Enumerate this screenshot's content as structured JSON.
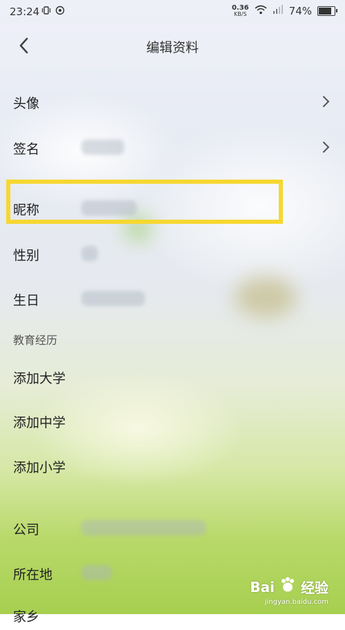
{
  "status_bar": {
    "time": "23:24",
    "speed_value": "0.36",
    "speed_unit": "KB/S",
    "battery_percent": "74%",
    "battery_level": 0.74
  },
  "header": {
    "title": "编辑资料"
  },
  "rows": {
    "avatar": "头像",
    "signature": "签名",
    "nickname": "昵称",
    "gender": "性别",
    "birthday": "生日",
    "add_university": "添加大学",
    "add_middle_school": "添加中学",
    "add_primary_school": "添加小学",
    "company": "公司",
    "location": "所在地",
    "hometown": "家乡"
  },
  "sections": {
    "education": "教育经历"
  },
  "watermark": {
    "brand": "Bai",
    "brand_suffix": "经验",
    "site": "jingyan.baidu.com"
  },
  "colors": {
    "highlight": "#f6d731"
  }
}
